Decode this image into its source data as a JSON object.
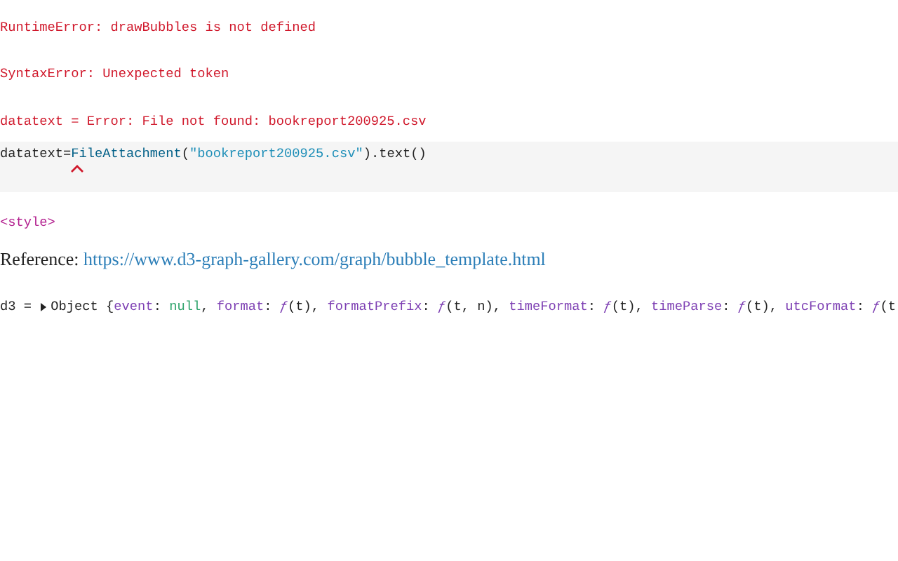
{
  "errors": [
    "RuntimeError: drawBubbles is not defined",
    "SyntaxError: Unexpected token",
    "datatext = Error: File not found: bookreport200925.csv"
  ],
  "code_cell": {
    "error_marker": true,
    "tokens": [
      {
        "text": "datatext=",
        "kind": "plain"
      },
      {
        "text": "FileAttachment",
        "kind": "call"
      },
      {
        "text": "(",
        "kind": "plain"
      },
      {
        "text": "\"bookreport200925.csv\"",
        "kind": "string"
      },
      {
        "text": ").text()",
        "kind": "plain"
      }
    ]
  },
  "html_output": "<style>",
  "reference": {
    "label": "Reference: ",
    "link": "https://www.d3-graph-gallery.com/graph/bubble_template.html"
  },
  "inspector": {
    "name": "d3 = ",
    "expanded": false,
    "type_label": "Object ",
    "tokens": [
      {
        "text": "{",
        "kind": "punct"
      },
      {
        "text": "event",
        "kind": "key"
      },
      {
        "text": ": ",
        "kind": "punct"
      },
      {
        "text": "null",
        "kind": "null"
      },
      {
        "text": ", ",
        "kind": "punct"
      },
      {
        "text": "format",
        "kind": "key"
      },
      {
        "text": ": ",
        "kind": "punct"
      },
      {
        "text": "ƒ",
        "kind": "fn"
      },
      {
        "text": "(t)",
        "kind": "punct"
      },
      {
        "text": ", ",
        "kind": "punct"
      },
      {
        "text": "formatPrefix",
        "kind": "key"
      },
      {
        "text": ": ",
        "kind": "punct"
      },
      {
        "text": "ƒ",
        "kind": "fn"
      },
      {
        "text": "(t, n)",
        "kind": "punct"
      },
      {
        "text": ", ",
        "kind": "punct"
      },
      {
        "text": "timeFormat",
        "kind": "key"
      },
      {
        "text": ": ",
        "kind": "punct"
      },
      {
        "text": "ƒ",
        "kind": "fn"
      },
      {
        "text": "(t)",
        "kind": "punct"
      },
      {
        "text": ", ",
        "kind": "punct"
      },
      {
        "text": "timeParse",
        "kind": "key"
      },
      {
        "text": ": ",
        "kind": "punct"
      },
      {
        "text": "ƒ",
        "kind": "fn"
      },
      {
        "text": "(t)",
        "kind": "punct"
      },
      {
        "text": ", ",
        "kind": "punct"
      },
      {
        "text": "utcFormat",
        "kind": "key"
      },
      {
        "text": ": ",
        "kind": "punct"
      },
      {
        "text": "ƒ",
        "kind": "fn"
      },
      {
        "text": "(t",
        "kind": "punct"
      }
    ]
  }
}
